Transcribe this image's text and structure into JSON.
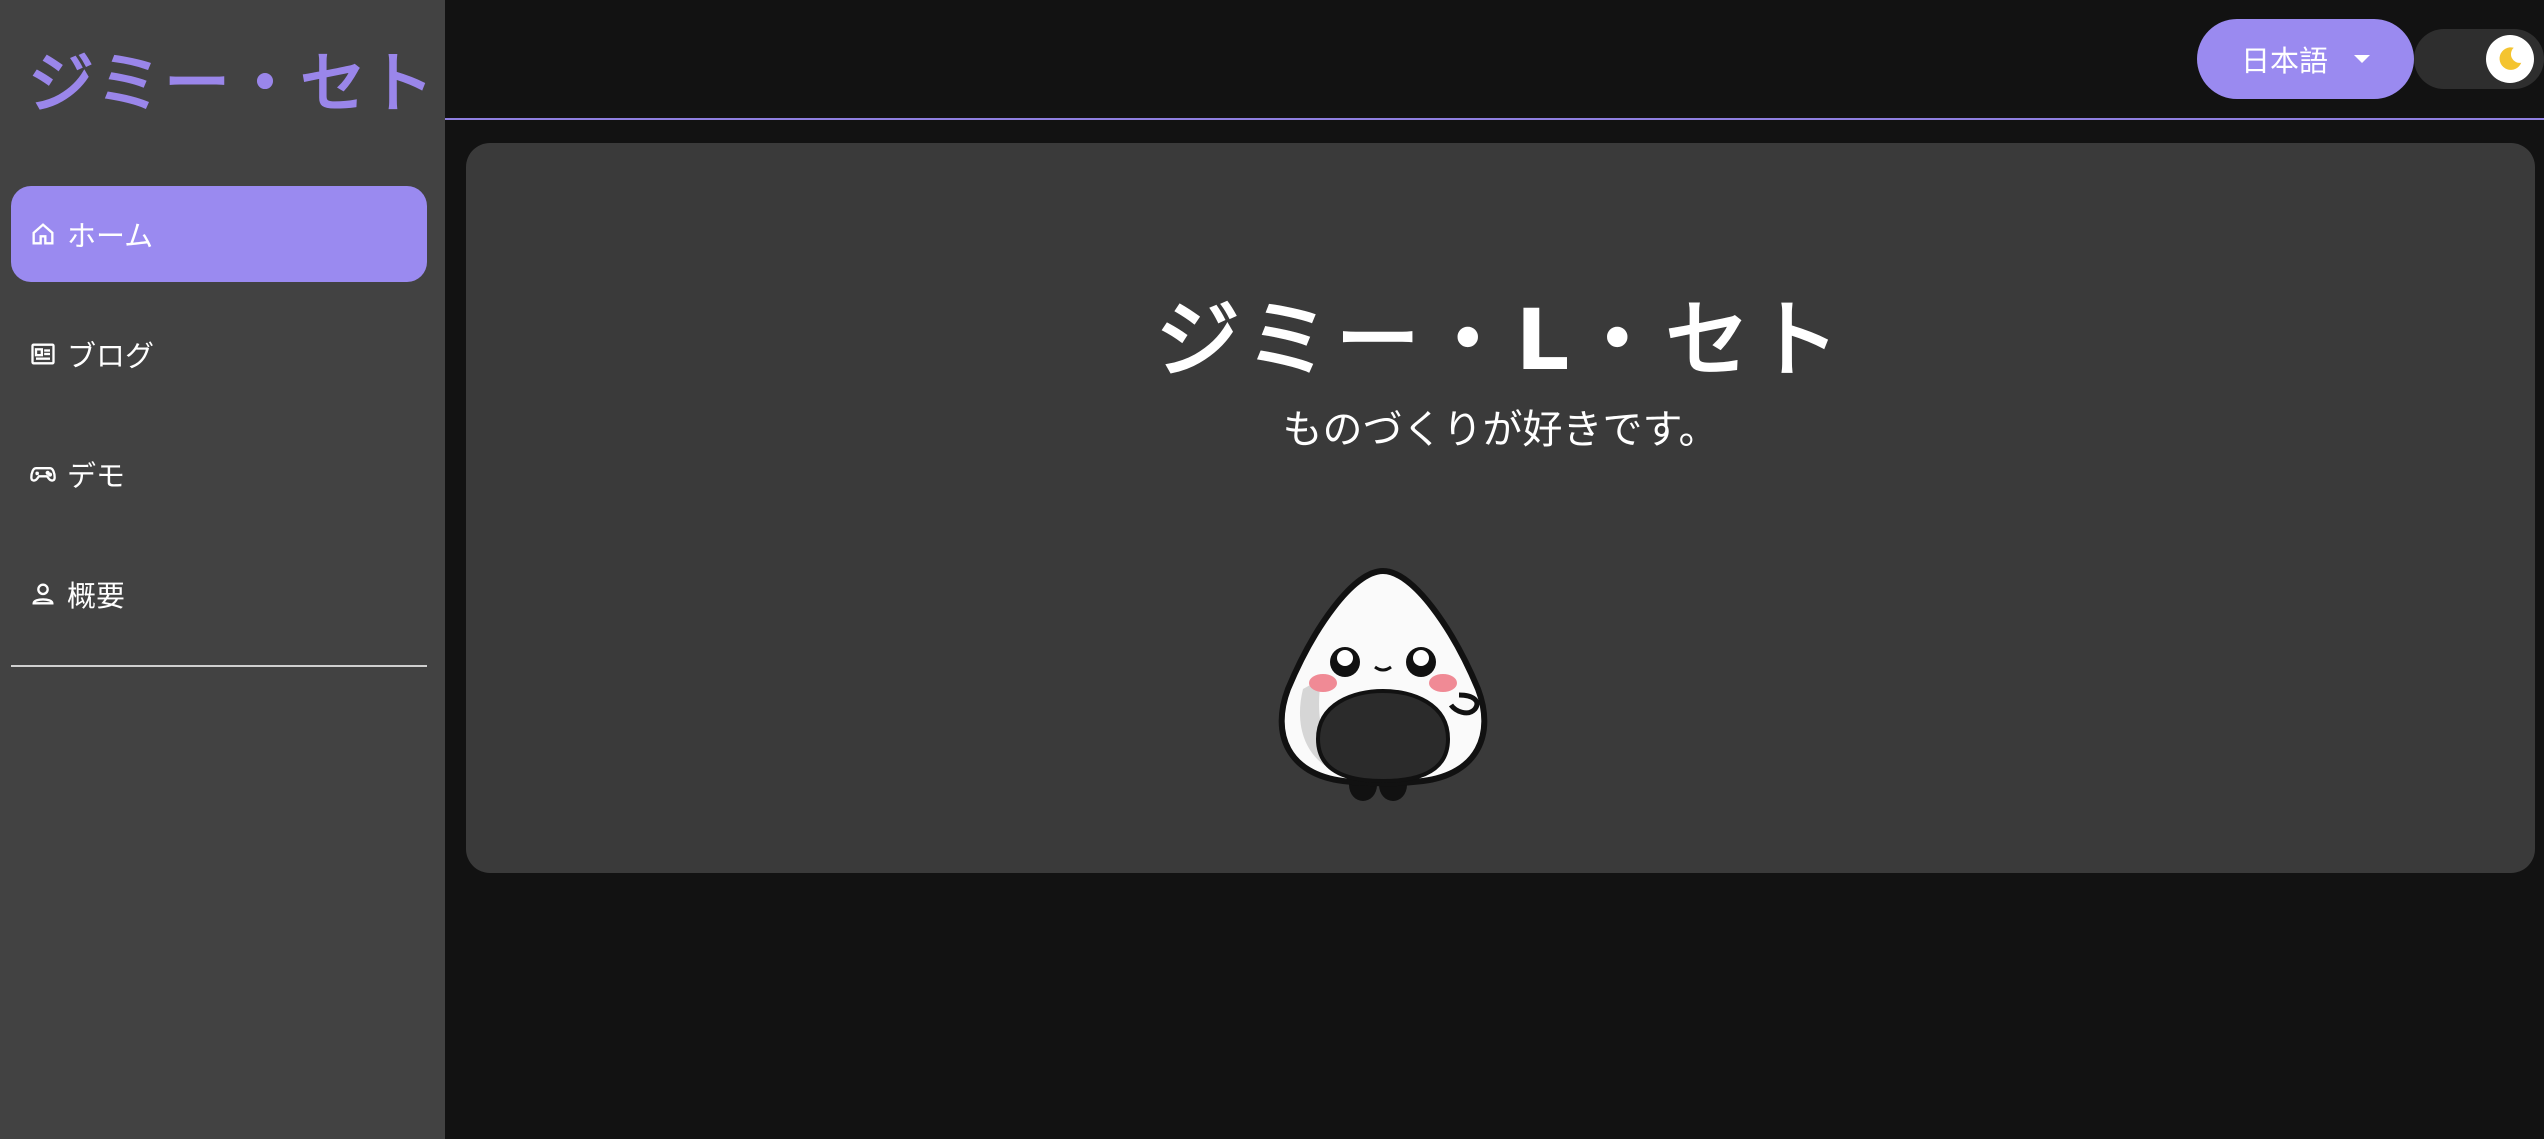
{
  "sidebar": {
    "brand": "ジミー・セト",
    "items": [
      {
        "label": "ホーム",
        "icon": "home-icon",
        "active": true
      },
      {
        "label": "ブログ",
        "icon": "newspaper-icon",
        "active": false
      },
      {
        "label": "デモ",
        "icon": "gamepad-icon",
        "active": false
      },
      {
        "label": "概要",
        "icon": "person-icon",
        "active": false
      }
    ]
  },
  "topbar": {
    "language_label": "日本語",
    "theme_icon": "moon-icon"
  },
  "hero": {
    "title": "ジミー・L・セト",
    "subtitle": "ものづくりが好きです。",
    "image": "onigiri-mascot"
  },
  "colors": {
    "accent": "#9a8af0",
    "sidebar_bg": "#424242",
    "page_bg": "#121212",
    "card_bg": "#3a3a3a"
  }
}
